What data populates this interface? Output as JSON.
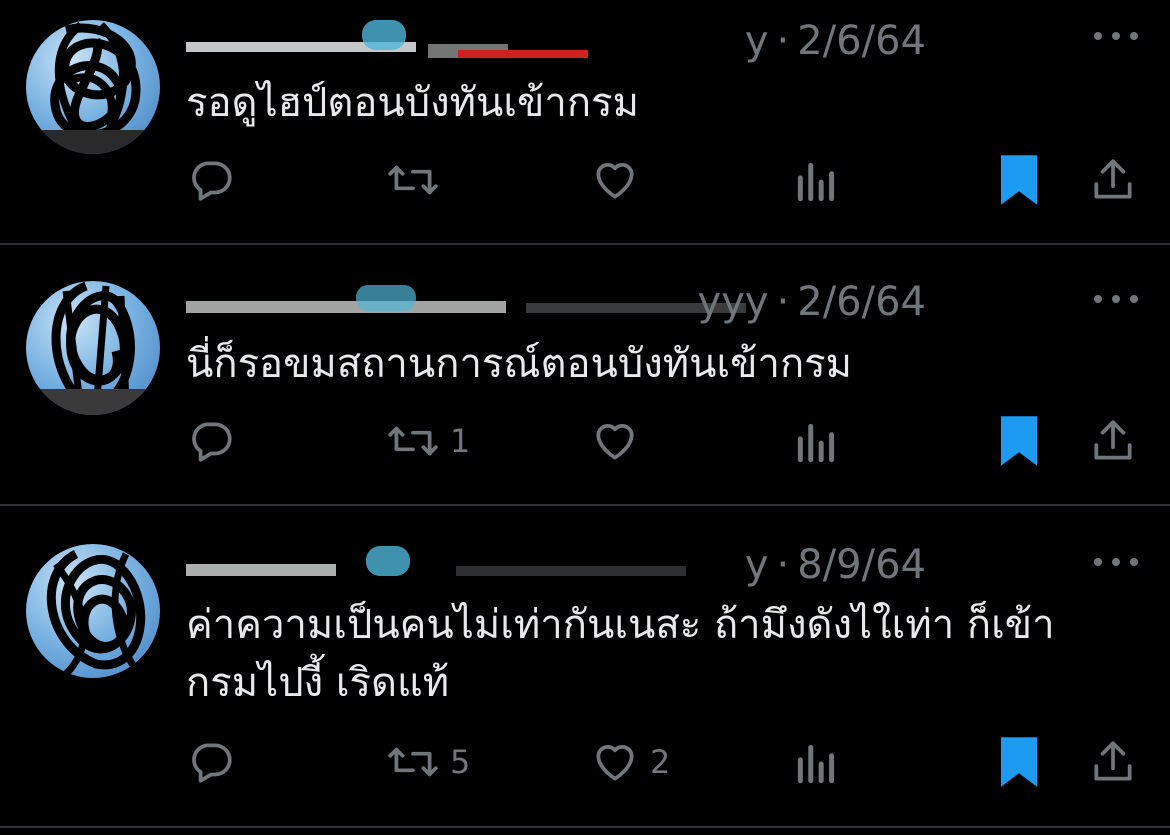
{
  "colors": {
    "background": "#000000",
    "text": "#e7e9ea",
    "muted": "#71767b",
    "divider": "#2f3336",
    "bookmark": "#1d9bf0"
  },
  "tweets": [
    {
      "handle_tail": "y",
      "separator": "·",
      "date": "2/6/64",
      "text": "รอดูไฮป์ตอนบังทันเข้ากรม",
      "reply_count": "",
      "retweet_count": "",
      "like_count": "",
      "bookmarked": true
    },
    {
      "handle_tail": "yyy",
      "separator": "·",
      "date": "2/6/64",
      "text": "นี่ก็รอขมสถานการณ์ตอนบังทันเข้ากรม",
      "reply_count": "",
      "retweet_count": "1",
      "like_count": "",
      "bookmarked": true
    },
    {
      "handle_tail": "y",
      "separator": "·",
      "date": "8/9/64",
      "text": "ค่าความเป็นคนไม่เท่ากันเนสะ ถ้ามึงดังไใเท่า ก็เข้ากรมไปงี้ เริดแท้",
      "reply_count": "",
      "retweet_count": "5",
      "like_count": "2",
      "bookmarked": true
    }
  ],
  "icons": {
    "reply": "reply-icon",
    "retweet": "retweet-icon",
    "like": "heart-icon",
    "views": "analytics-icon",
    "bookmark": "bookmark-icon",
    "share": "share-icon",
    "more": "more-icon"
  }
}
